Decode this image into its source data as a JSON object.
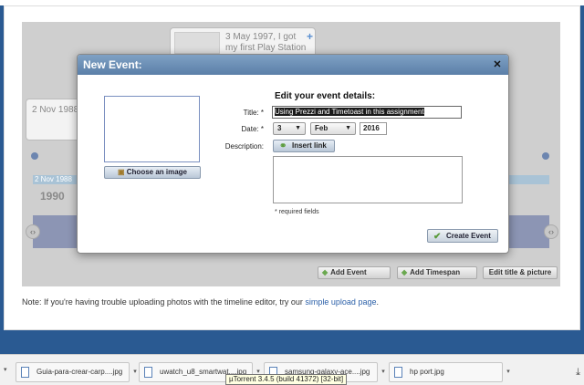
{
  "background_timeline": {
    "bubble_top_text": "3 May 1997, I got my first Play Station",
    "bubble_left_text": "2 Nov 1988",
    "band_label": "2 Nov 1988",
    "year": "1990",
    "prev_icon": "‹›",
    "buttons": {
      "add_event": "Add Event",
      "add_timespan": "Add Timespan",
      "edit_title": "Edit title & picture"
    }
  },
  "note": {
    "prefix": "Note: If you're having trouble uploading photos with the timeline editor, try our ",
    "link": "simple upload page",
    "suffix": "."
  },
  "modal": {
    "title": "New Event:",
    "close": "✕",
    "choose_image": "Choose an image",
    "heading": "Edit your event details:",
    "title_label": "Title: *",
    "title_value": "Using Prezzi and Timetoast in this assignment",
    "date_label": "Date: *",
    "day": "3",
    "month": "Feb",
    "year": "2016",
    "description_label": "Description:",
    "insert_link": "Insert link",
    "required_note": "* required fields",
    "create_event": "Create Event"
  },
  "downloads": {
    "items": [
      {
        "name": "Guia-para-crear-carp....jpg"
      },
      {
        "name": "uwatch_u8_smartwat....jpg"
      },
      {
        "name": "samsung-galaxy-ace....jpg"
      },
      {
        "name": "hp port.jpg"
      }
    ],
    "tooltip": "µTorrent 3.4.5  (build 41372) [32-bit]"
  },
  "colors": {
    "modal_header": "#6a8db4",
    "page_background": "#2a5a92",
    "band": "#a9c3d6"
  }
}
